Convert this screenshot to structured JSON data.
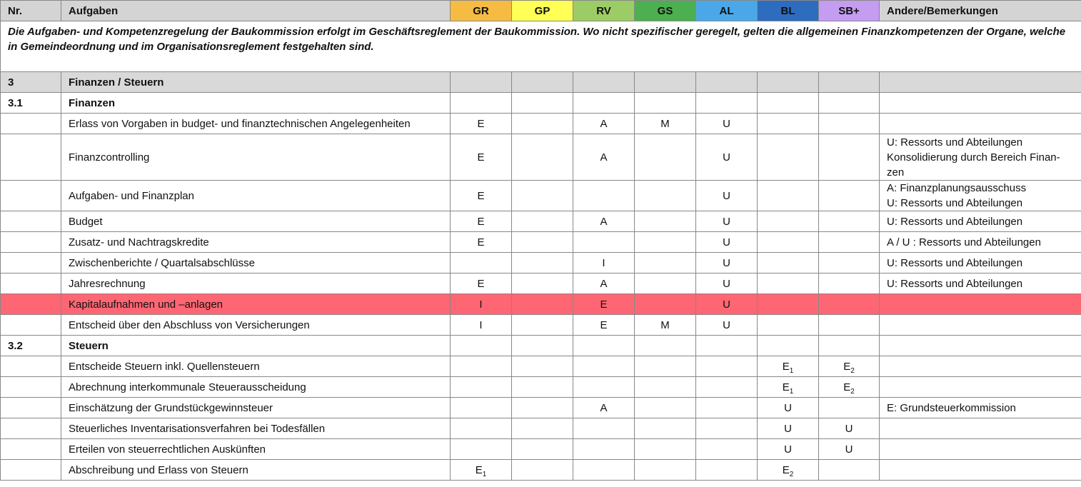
{
  "header": {
    "nr": "Nr.",
    "aufgaben": "Aufgaben",
    "roles": [
      {
        "label": "GR",
        "color": "#f6bb42"
      },
      {
        "label": "GP",
        "color": "#ffff55"
      },
      {
        "label": "RV",
        "color": "#9ccc65"
      },
      {
        "label": "GS",
        "color": "#4caf50"
      },
      {
        "label": "AL",
        "color": "#4aa8e8"
      },
      {
        "label": "BL",
        "color": "#2e6cc0"
      },
      {
        "label": "SB+",
        "color": "#c49cf0"
      }
    ],
    "remarks": "Andere/Bemerkungen"
  },
  "note": "Die Aufgaben- und Kompetenzregelung der Baukommission erfolgt im Geschäftsreglement der Baukommission. Wo nicht spezifischer geregelt, gelten die allgemeinen Finanzkompetenzen der Organe, welche in Gemeindeordnung und im Organisationsreglement festgehalten sind.",
  "section": {
    "nr": "3",
    "title": "Finanzen / Steuern"
  },
  "sub1": {
    "nr": "3.1",
    "title": "Finanzen"
  },
  "sub2": {
    "nr": "3.2",
    "title": "Steuern"
  },
  "rows1": [
    {
      "task": "Erlass von Vorgaben in budget- und finanztechnischen Angelegenheiten",
      "GR": "E",
      "GP": "",
      "RV": "A",
      "GS": "M",
      "AL": "U",
      "BL": "",
      "SB": "",
      "rem": []
    },
    {
      "task": "Finanzcontrolling",
      "GR": "E",
      "GP": "",
      "RV": "A",
      "GS": "",
      "AL": "U",
      "BL": "",
      "SB": "",
      "rem": [
        "U: Ressorts und Abteilungen",
        "Konsolidierung durch Bereich Finan-",
        "zen"
      ]
    },
    {
      "task": "Aufgaben- und Finanzplan",
      "GR": "E",
      "GP": "",
      "RV": "",
      "GS": "",
      "AL": "U",
      "BL": "",
      "SB": "",
      "rem": [
        "A: Finanzplanungsausschuss",
        "U: Ressorts und Abteilungen"
      ]
    },
    {
      "task": "Budget",
      "GR": "E",
      "GP": "",
      "RV": "A",
      "GS": "",
      "AL": "U",
      "BL": "",
      "SB": "",
      "rem": [
        "U: Ressorts und Abteilungen"
      ]
    },
    {
      "task": "Zusatz- und Nachtragskredite",
      "GR": "E",
      "GP": "",
      "RV": "",
      "GS": "",
      "AL": "U",
      "BL": "",
      "SB": "",
      "rem": [
        "A / U : Ressorts und Abteilungen"
      ]
    },
    {
      "task": "Zwischenberichte / Quartalsabschlüsse",
      "GR": "",
      "GP": "",
      "RV": "I",
      "GS": "",
      "AL": "U",
      "BL": "",
      "SB": "",
      "rem": [
        "U: Ressorts und Abteilungen"
      ]
    },
    {
      "task": "Jahresrechnung",
      "GR": "E",
      "GP": "",
      "RV": "A",
      "GS": "",
      "AL": "U",
      "BL": "",
      "SB": "",
      "rem": [
        "U: Ressorts und Abteilungen"
      ]
    },
    {
      "task": "Kapitalaufnahmen und –anlagen",
      "GR": "I",
      "GP": "",
      "RV": "E",
      "GS": "",
      "AL": "U",
      "BL": "",
      "SB": "",
      "rem": [],
      "highlight": true
    },
    {
      "task": "Entscheid über den Abschluss von Versicherungen",
      "GR": "I",
      "GP": "",
      "RV": "E",
      "GS": "M",
      "AL": "U",
      "BL": "",
      "SB": "",
      "rem": []
    }
  ],
  "rows2": [
    {
      "task": "Entscheide Steuern inkl. Quellensteuern",
      "GR": "",
      "GP": "",
      "RV": "",
      "GS": "",
      "AL": "",
      "BL": "E|1",
      "SB": "E|2",
      "rem": []
    },
    {
      "task": "Abrechnung interkommunale Steuerausscheidung",
      "GR": "",
      "GP": "",
      "RV": "",
      "GS": "",
      "AL": "",
      "BL": "E|1",
      "SB": "E|2",
      "rem": []
    },
    {
      "task": "Einschätzung der Grundstückgewinnsteuer",
      "GR": "",
      "GP": "",
      "RV": "A",
      "GS": "",
      "AL": "",
      "BL": "U",
      "SB": "",
      "rem": [
        "E: Grundsteuerkommission"
      ]
    },
    {
      "task": "Steuerliches Inventarisationsverfahren bei Todesfällen",
      "GR": "",
      "GP": "",
      "RV": "",
      "GS": "",
      "AL": "",
      "BL": "U",
      "SB": "U",
      "rem": []
    },
    {
      "task": "Erteilen von steuerrechtlichen Auskünften",
      "GR": "",
      "GP": "",
      "RV": "",
      "GS": "",
      "AL": "",
      "BL": "U",
      "SB": "U",
      "rem": []
    },
    {
      "task": "Abschreibung und Erlass von Steuern",
      "GR": "E|1",
      "GP": "",
      "RV": "",
      "GS": "",
      "AL": "",
      "BL": "E|2",
      "SB": "",
      "rem": []
    }
  ]
}
